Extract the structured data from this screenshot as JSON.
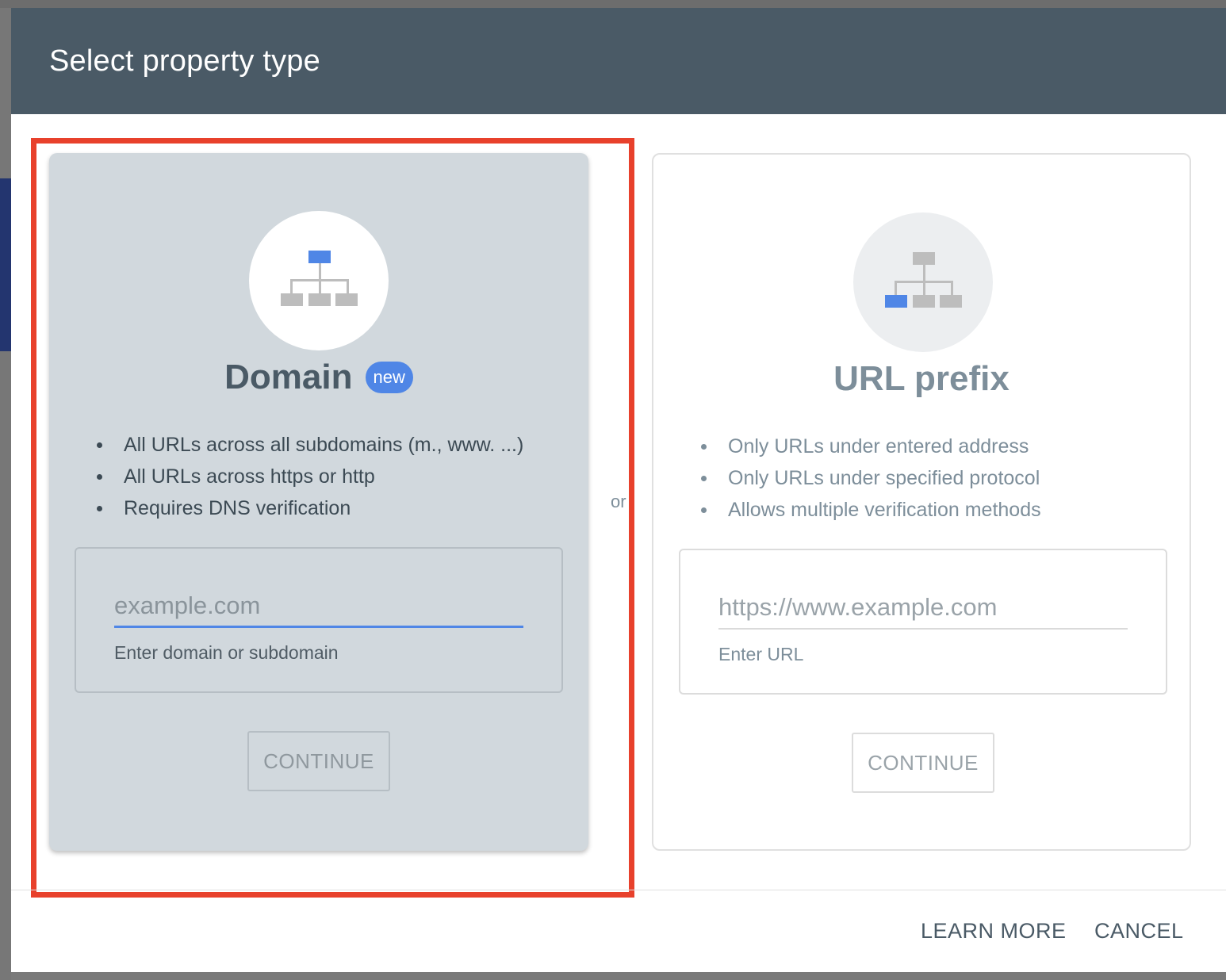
{
  "dialog": {
    "title": "Select property type",
    "separator": "or"
  },
  "domain_card": {
    "title": "Domain",
    "badge": "new",
    "bullets": [
      "All URLs across all subdomains (m., www. ...)",
      "All URLs across https or http",
      "Requires DNS verification"
    ],
    "input_placeholder": "example.com",
    "input_value": "",
    "input_help": "Enter domain or subdomain",
    "continue_label": "CONTINUE",
    "icon": "sitemap-icon",
    "highlighted": true
  },
  "url_card": {
    "title": "URL prefix",
    "bullets": [
      "Only URLs under entered address",
      "Only URLs under specified protocol",
      "Allows multiple verification methods"
    ],
    "input_placeholder": "https://www.example.com",
    "input_value": "",
    "input_help": "Enter URL",
    "continue_label": "CONTINUE",
    "icon": "sitemap-icon"
  },
  "footer": {
    "learn_more_label": "LEARN MORE",
    "cancel_label": "CANCEL"
  },
  "colors": {
    "header_bg": "#4a5a66",
    "accent_blue": "#4f86e6",
    "highlight_red": "#e8412c",
    "domain_card_bg": "#d1d8dd"
  }
}
